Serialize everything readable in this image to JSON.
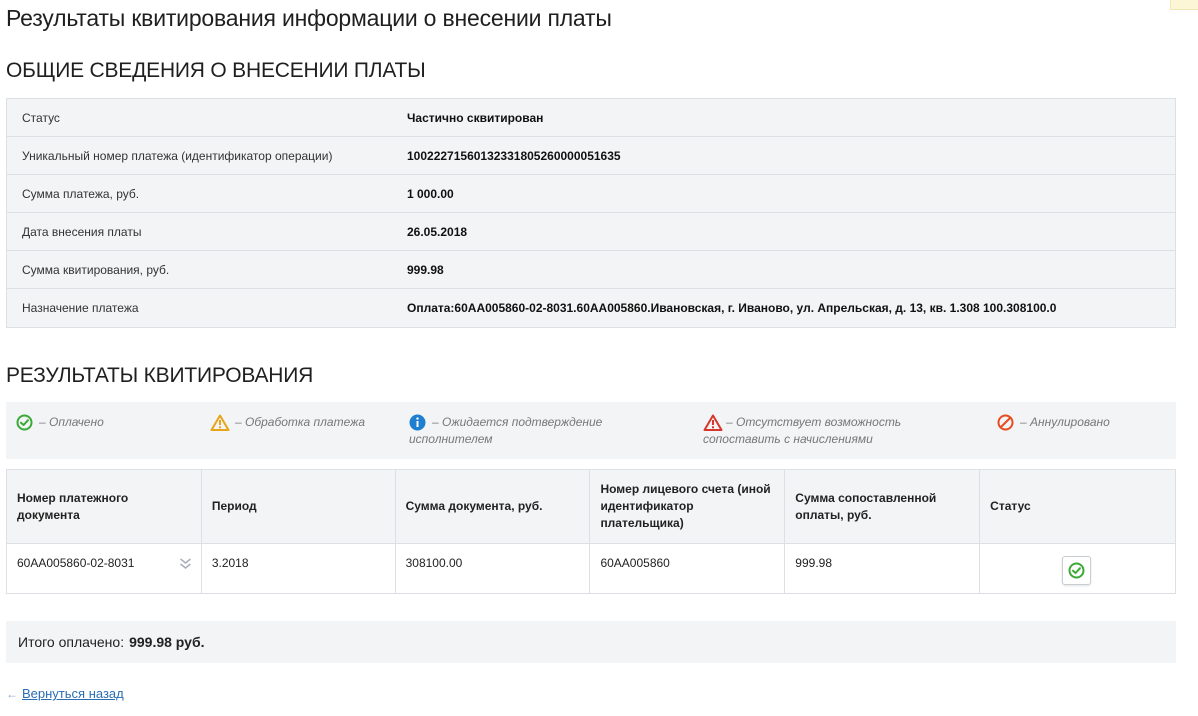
{
  "page": {
    "title": "Результаты квитирования информации о внесении платы"
  },
  "general": {
    "title": "ОБЩИЕ СВЕДЕНИЯ О ВНЕСЕНИИ ПЛАТЫ",
    "rows": [
      {
        "label": "Статус",
        "value": "Частично сквитирован"
      },
      {
        "label": "Уникальный номер платежа (идентификатор операции)",
        "value": "10022271560132331805260000051635"
      },
      {
        "label": "Сумма платежа, руб.",
        "value": "1 000.00"
      },
      {
        "label": "Дата внесения платы",
        "value": "26.05.2018"
      },
      {
        "label": "Сумма квитирования, руб.",
        "value": "999.98"
      },
      {
        "label": "Назначение платежа",
        "value": "Оплата:60АА005860-02-8031.60АА005860.Ивановская, г. Иваново, ул. Апрельская, д. 13, кв. 1.308 100.308100.0"
      }
    ]
  },
  "results": {
    "title": "РЕЗУЛЬТАТЫ КВИТИРОВАНИЯ",
    "legend": [
      {
        "icon": "check-circle-icon",
        "color": "#3aaa35",
        "text": "– Оплачено"
      },
      {
        "icon": "warning-icon",
        "color": "#e8a417",
        "text": "– Обработка платежа"
      },
      {
        "icon": "info-icon",
        "color": "#1e7fd0",
        "text": "– Ожидается подтверждение исполнителем"
      },
      {
        "icon": "alert-icon",
        "color": "#d9362b",
        "text": "– Отсутствует возможность сопоставить с начислениями"
      },
      {
        "icon": "cancel-icon",
        "color": "#e84b1e",
        "text": "– Аннулировано"
      }
    ],
    "columns": [
      "Номер платежного документа",
      "Период",
      "Сумма документа, руб.",
      "Номер лицевого счета (иной идентификатор плательщика)",
      "Сумма сопоставленной оплаты, руб.",
      "Статус"
    ],
    "rows": [
      {
        "doc": "60АА005860-02-8031",
        "period": "3.2018",
        "amount": "308100.00",
        "account": "60АА005860",
        "matched": "999.98",
        "status": "check-circle-icon"
      }
    ]
  },
  "total": {
    "label": "Итого оплачено:",
    "value": "999.98 руб."
  },
  "back": {
    "label": "Вернуться назад"
  }
}
